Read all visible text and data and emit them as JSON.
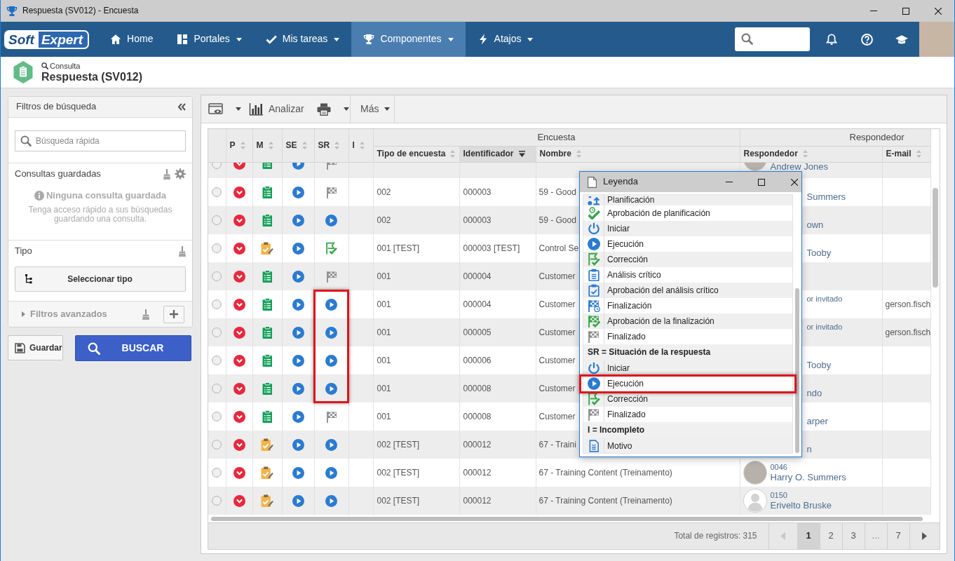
{
  "window": {
    "title": "Respuesta (SV012) - Encuesta"
  },
  "navbar": {
    "logo": [
      "Soft",
      "Expert"
    ],
    "items": [
      {
        "label": "Home",
        "kind": "home",
        "dropdown": false,
        "selected": false
      },
      {
        "label": "Portales",
        "kind": "portals",
        "dropdown": true,
        "selected": false
      },
      {
        "label": "Mis tareas",
        "kind": "tasks",
        "dropdown": true,
        "selected": false
      },
      {
        "label": "Componentes",
        "kind": "components",
        "dropdown": true,
        "selected": true
      },
      {
        "label": "Atajos",
        "kind": "shortcuts",
        "dropdown": true,
        "selected": false
      }
    ]
  },
  "header": {
    "breadcrumb": "Consulta",
    "title": "Respuesta (SV012)"
  },
  "filters": {
    "title": "Filtros de búsqueda",
    "search": {
      "placeholder": "Búsqueda rápida"
    },
    "saved": {
      "title": "Consultas guardadas",
      "empty_title": "Ninguna consulta guardada",
      "empty_text": "Tenga acceso rápido a sus búsquedas guardando una consulta."
    },
    "type": {
      "title": "Tipo",
      "button": "Seleccionar tipo"
    },
    "advanced": {
      "title": "Filtros avanzados",
      "expanded": false
    }
  },
  "actions": {
    "save": "Guardar",
    "search": "BUSCAR"
  },
  "toolbar": {
    "items": [
      {
        "kind": "view",
        "dropdown": true
      },
      {
        "kind": "analyze",
        "label": "Analizar",
        "dropdown": false
      },
      {
        "kind": "print",
        "dropdown": true
      },
      {
        "kind": "more",
        "label": "Más",
        "dropdown": true
      }
    ]
  },
  "table": {
    "columns": [
      {
        "label": "P",
        "sorted": false
      },
      {
        "label": "M",
        "sorted": false
      },
      {
        "label": "SE",
        "sorted": false
      },
      {
        "label": "SR",
        "sorted": false
      },
      {
        "label": "I",
        "sorted": false
      }
    ],
    "groups": [
      {
        "label": "Encuesta",
        "columns": [
          {
            "label": "Tipo de encuesta",
            "sorted": false
          },
          {
            "label": "Identificador",
            "sorted": true
          },
          {
            "label": "Nombre",
            "sorted": false
          }
        ]
      },
      {
        "label": "Respondedor",
        "columns": [
          {
            "label": "Respondedor",
            "sorted": false
          },
          {
            "label": "E-mail",
            "sorted": false
          }
        ]
      }
    ],
    "partial_top_row": {
      "selected": false,
      "p": {
        "kind": "down"
      },
      "m": {
        "kind": "form"
      },
      "se": {
        "kind": "execution"
      },
      "sr": {
        "kind": "finished"
      },
      "responder": {
        "avatar": {
          "kind": "photo"
        },
        "name": "Andrew Jones"
      }
    },
    "rows": [
      {
        "selected": false,
        "p": {
          "kind": "down"
        },
        "m": {
          "kind": "form"
        },
        "se": {
          "kind": "execution"
        },
        "sr": {
          "kind": "finished",
          "marked": false
        },
        "type": "002",
        "id": "000003",
        "name": "59 - Good",
        "responder": {
          "name": "Summers"
        }
      },
      {
        "selected": false,
        "p": {
          "kind": "down"
        },
        "m": {
          "kind": "form"
        },
        "se": {
          "kind": "execution"
        },
        "sr": {
          "kind": "execution",
          "marked": false
        },
        "type": "002",
        "id": "000003",
        "name": "59 - Good",
        "responder": {
          "name": "own"
        }
      },
      {
        "selected": false,
        "p": {
          "kind": "down"
        },
        "m": {
          "kind": "edit"
        },
        "se": {
          "kind": "execution"
        },
        "sr": {
          "kind": "correction",
          "marked": false
        },
        "type": "001 [TEST]",
        "id": "000003 [TEST]",
        "name": "Control Se",
        "responder": {
          "name": "Tooby"
        }
      },
      {
        "selected": false,
        "p": {
          "kind": "down"
        },
        "m": {
          "kind": "form"
        },
        "se": {
          "kind": "execution"
        },
        "sr": {
          "kind": "finished",
          "marked": false
        },
        "type": "001",
        "id": "000004",
        "name": "Customer"
      },
      {
        "selected": false,
        "p": {
          "kind": "down"
        },
        "m": {
          "kind": "form"
        },
        "se": {
          "kind": "execution"
        },
        "sr": {
          "kind": "execution",
          "marked": true
        },
        "type": "001",
        "id": "000004",
        "name": "Customer",
        "responder": {
          "small_line": "or invitado"
        },
        "email": "gerson.fisch"
      },
      {
        "selected": false,
        "p": {
          "kind": "down"
        },
        "m": {
          "kind": "form"
        },
        "se": {
          "kind": "execution"
        },
        "sr": {
          "kind": "execution",
          "marked": true
        },
        "type": "001",
        "id": "000005",
        "name": "Customer",
        "responder": {
          "small_line": "or invitado"
        },
        "email": "gerson.fisch"
      },
      {
        "selected": false,
        "p": {
          "kind": "down"
        },
        "m": {
          "kind": "form"
        },
        "se": {
          "kind": "execution"
        },
        "sr": {
          "kind": "execution",
          "marked": true
        },
        "type": "001",
        "id": "000006",
        "name": "Customer",
        "responder": {
          "name": "Tooby"
        }
      },
      {
        "selected": false,
        "p": {
          "kind": "down"
        },
        "m": {
          "kind": "form"
        },
        "se": {
          "kind": "execution"
        },
        "sr": {
          "kind": "execution",
          "marked": true
        },
        "type": "001",
        "id": "000008",
        "name": "Customer",
        "responder": {
          "name": "ndo"
        }
      },
      {
        "selected": false,
        "p": {
          "kind": "down"
        },
        "m": {
          "kind": "form"
        },
        "se": {
          "kind": "execution"
        },
        "sr": {
          "kind": "finished",
          "marked": false
        },
        "type": "001",
        "id": "000008",
        "name": "Customer",
        "responder": {
          "name": "arper"
        }
      },
      {
        "selected": false,
        "p": {
          "kind": "down"
        },
        "m": {
          "kind": "edit"
        },
        "se": {
          "kind": "execution"
        },
        "sr": {
          "kind": "execution",
          "marked": false
        },
        "type": "002 [TEST]",
        "id": "000012",
        "name": "67 - Traini",
        "responder": {
          "name": "n"
        }
      },
      {
        "selected": false,
        "p": {
          "kind": "down"
        },
        "m": {
          "kind": "edit"
        },
        "se": {
          "kind": "execution"
        },
        "sr": {
          "kind": "execution",
          "marked": false
        },
        "type": "002 [TEST]",
        "id": "000012",
        "name": "67 - Training Content (Treinamento)",
        "responder": {
          "avatar": {
            "kind": "photo"
          },
          "small_line": "0046",
          "name": "Harry O. Summers"
        }
      },
      {
        "selected": false,
        "p": {
          "kind": "down"
        },
        "m": {
          "kind": "edit"
        },
        "se": {
          "kind": "execution"
        },
        "sr": {
          "kind": "execution",
          "marked": false
        },
        "type": "002 [TEST]",
        "id": "000012",
        "name": "67 - Training Content (Treinamento)",
        "responder": {
          "avatar": {
            "kind": "default"
          },
          "small_line": "0150",
          "name": "Erivelto Bruske"
        }
      }
    ]
  },
  "footer": {
    "total": "Total de registros: 315",
    "pages": [
      {
        "kind": "prev",
        "disabled": true
      },
      {
        "kind": "page",
        "label": "1",
        "selected": true
      },
      {
        "kind": "page",
        "label": "2",
        "selected": false
      },
      {
        "kind": "page",
        "label": "3",
        "selected": false
      },
      {
        "kind": "gap",
        "label": "..."
      },
      {
        "kind": "page",
        "label": "7",
        "selected": false
      },
      {
        "kind": "next",
        "disabled": false
      }
    ]
  },
  "legend": {
    "title": "Leyenda",
    "groups": [
      {
        "items": [
          {
            "label": "Planificación",
            "kind": "planning",
            "marked": false
          },
          {
            "label": "Aprobación de planificación",
            "kind": "planning-approval",
            "marked": false
          },
          {
            "label": "Iniciar",
            "kind": "start",
            "marked": false
          },
          {
            "label": "Ejecución",
            "kind": "execution",
            "marked": false
          },
          {
            "label": "Corrección",
            "kind": "correction",
            "marked": false
          },
          {
            "label": "Análisis crítico",
            "kind": "review",
            "marked": false
          },
          {
            "label": "Aprobación del análisis crítico",
            "kind": "review-approval",
            "marked": false
          },
          {
            "label": "Finalización",
            "kind": "closing",
            "marked": false
          },
          {
            "label": "Aprobación de la finalización",
            "kind": "closing-approval",
            "marked": false
          },
          {
            "label": "Finalizado",
            "kind": "finished",
            "marked": false
          }
        ]
      },
      {
        "heading": "SR = Situación de la respuesta",
        "items": [
          {
            "label": "Iniciar",
            "kind": "start",
            "marked": false
          },
          {
            "label": "Ejecución",
            "kind": "execution",
            "marked": true
          },
          {
            "label": "Corrección",
            "kind": "correction",
            "marked": false
          },
          {
            "label": "Finalizado",
            "kind": "finished",
            "marked": false
          }
        ]
      },
      {
        "heading": "I = Incompleto",
        "items": [
          {
            "label": "Motivo",
            "kind": "reason",
            "marked": false
          }
        ]
      }
    ]
  }
}
